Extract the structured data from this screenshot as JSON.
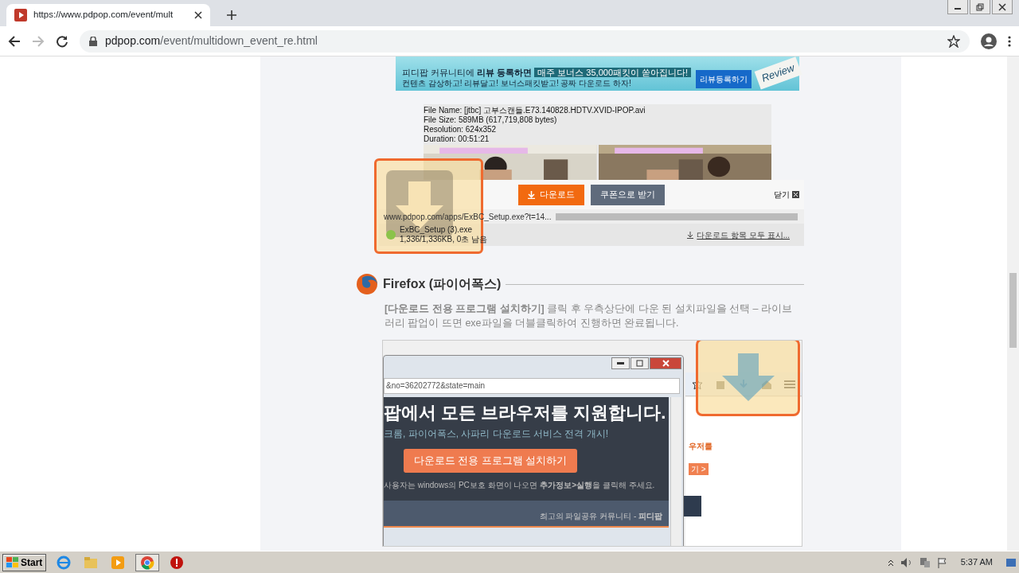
{
  "browser": {
    "tab": {
      "title": "https://www.pdpop.com/event/mult"
    },
    "address": {
      "host": "pdpop.com",
      "path": "/event/multidown_event_re.html"
    }
  },
  "banner": {
    "line_1": "피디팝 커뮤니티에 **리뷰 등록하면**",
    "badge": "매주 보너스 35,000패킷이 쏟아집니다!",
    "line_2": "컨텐츠 감상하고! 리뷰달고! 보너스패킷받고! 공짜 다운로드 하자!",
    "button": "리뷰등록하기",
    "stamp": "Review"
  },
  "file_info": [
    "File Name: [jtbc] 고부스캔들.E73.140828.HDTV.XVID-IPOP.avi",
    "File Size: 589MB (617,719,808 bytes)",
    "Resolution: 624x352",
    "Duration: 00:51:21"
  ],
  "download_bar": {
    "buttons": [
      {
        "label": "다운로드",
        "kind": "primary"
      },
      {
        "label": "쿠폰으로 받기",
        "kind": "secondary"
      }
    ],
    "close": "닫기",
    "url": "www.pdpop.com/apps/ExBC_Setup.exe?t=14...",
    "file_name": "ExBC_Setup (3).exe",
    "progress": "1,336/1,336KB, 0초 남음",
    "show_all": "다운로드 항목 모두 표시..."
  },
  "firefox": {
    "title": "Firefox (파이어폭스)",
    "text": "**[다운로드 전용 프로그램 설치하기]** 클릭 후 우측상단에 다운 된 설치파일을 선택 – 라이브러리 팝업이 뜨면 exe파일을 더블클릭하여 진행하면 완료됩니다."
  },
  "firefox_shot": {
    "url": "&no=36202772&state=main",
    "headline": "팝에서 **모든 브라우저**를 지원합니다.",
    "subline": "크롬, 파이어폭스, 사파리 다운로드 서비스 전격 개시!",
    "button": "다운로드 전용 프로그램 설치하기",
    "note": "사용자는 windows의 PC보호 화면이 나오면 **추가정보>실행**을 클릭해 주세요.",
    "footer": "최고의 파일공유 커뮤니티 - **피디팝**",
    "side_text": "우저를",
    "side_link": "기 >"
  },
  "taskbar": {
    "start": "Start",
    "clock": "5:37 AM"
  }
}
